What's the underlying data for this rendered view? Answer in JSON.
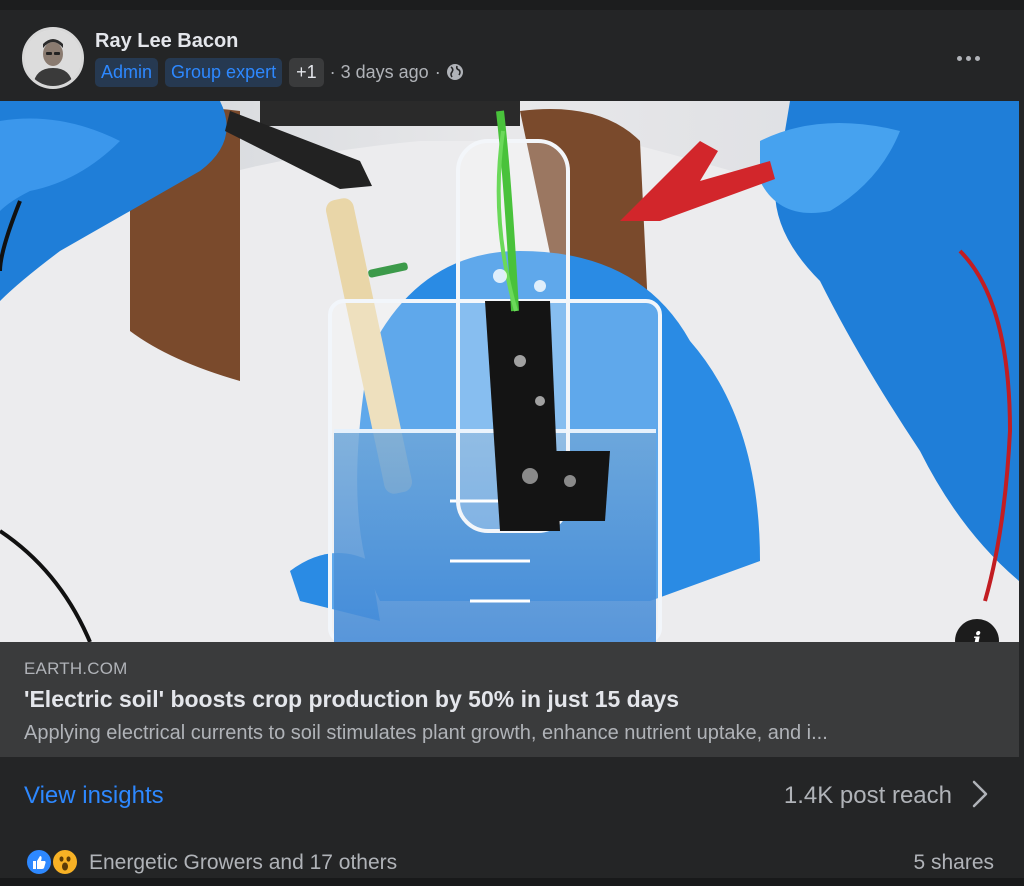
{
  "post": {
    "author": "Ray Lee Bacon",
    "badges": [
      "Admin",
      "Group expert"
    ],
    "badge_more": "+1",
    "separator": "·",
    "time": "3 days ago",
    "privacy_icon": "globe-icon",
    "more_icon": "more-options-icon"
  },
  "link": {
    "domain": "EARTH.COM",
    "headline": "'Electric soil' boosts crop production by 50% in just 15 days",
    "description": "Applying electrical currents to soil stimulates plant growth, enhance nutrient uptake, and i...",
    "info_label": "i",
    "image_alt": "Scientist in blue gloves holding a plant in a beaker with electrodes attached"
  },
  "insights": {
    "view_label": "View insights",
    "reach": "1.4K post reach"
  },
  "reactions": {
    "icons": [
      "like-reaction-icon",
      "wow-reaction-icon"
    ],
    "summary": "Energetic Growers and 17 others",
    "shares": "5 shares"
  },
  "colors": {
    "background": "#242526",
    "link_blue": "#2d88ff",
    "badge_bg": "#263951",
    "secondary_text": "#b0b3b8",
    "preview_bg": "#3a3b3c"
  }
}
